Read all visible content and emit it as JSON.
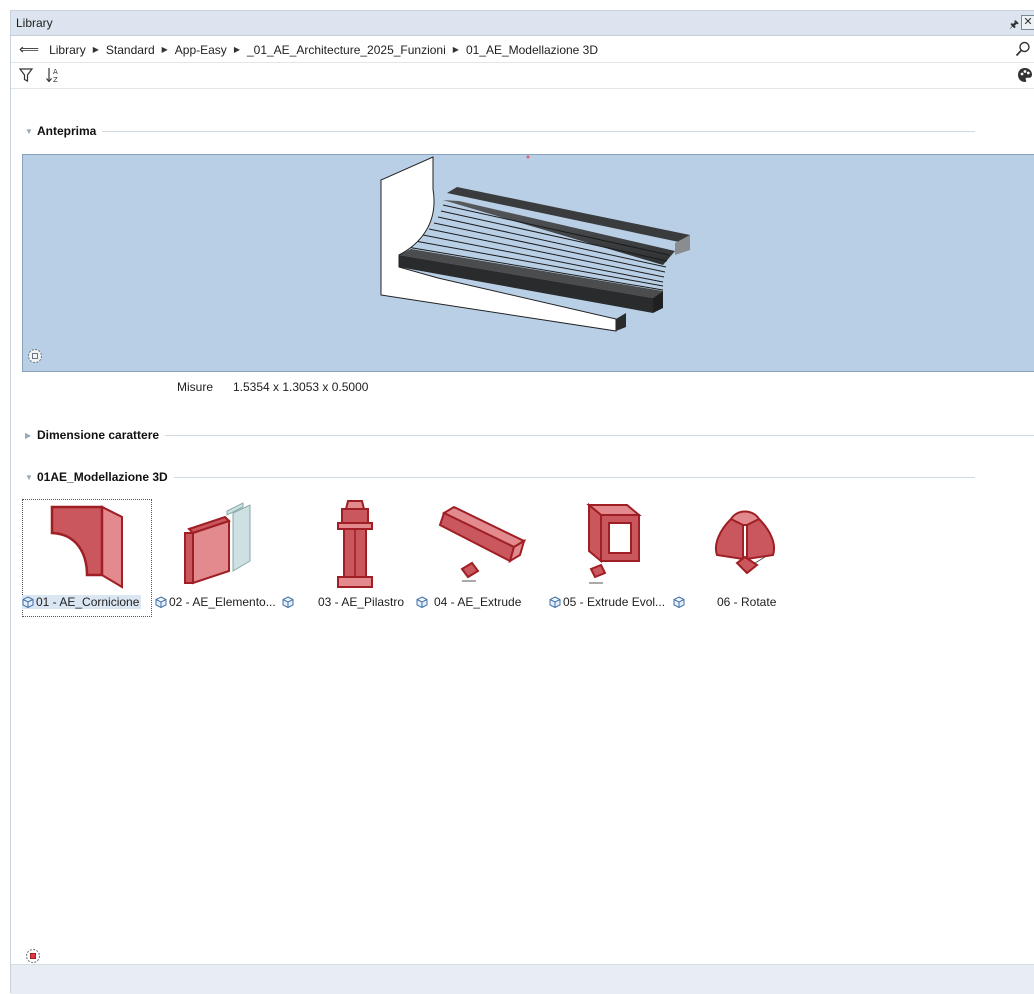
{
  "window": {
    "title": "Library"
  },
  "breadcrumb": [
    "Library",
    "Standard",
    "App-Easy",
    "_01_AE_Architecture_2025_Funzioni",
    "01_AE_Modellazione 3D"
  ],
  "sections": {
    "preview": "Anteprima",
    "font_size": "Dimensione carattere",
    "folder": "01AE_Modellazione 3D"
  },
  "preview": {
    "measure_label": "Misure",
    "measure_value": "1.5354 x 1.3053 x 0.5000"
  },
  "items": [
    {
      "label": "01 - AE_Cornicione",
      "selected": true
    },
    {
      "label": "02 - AE_Elemento...",
      "selected": false
    },
    {
      "label": "03 - AE_Pilastro",
      "selected": false
    },
    {
      "label": "04 - AE_Extrude",
      "selected": false
    },
    {
      "label": "05 - Extrude Evol...",
      "selected": false
    },
    {
      "label": "06 - Rotate",
      "selected": false
    }
  ],
  "colors": {
    "accent": "#a01f25",
    "fill": "#c9575d",
    "preview_bg": "#b9cfe6",
    "titlebar": "#dbe4ef"
  },
  "icons": [
    "back-arrow-icon",
    "search-icon",
    "filter-icon",
    "sort-icon",
    "palette-icon",
    "view-cube-icon",
    "cube-icon"
  ]
}
